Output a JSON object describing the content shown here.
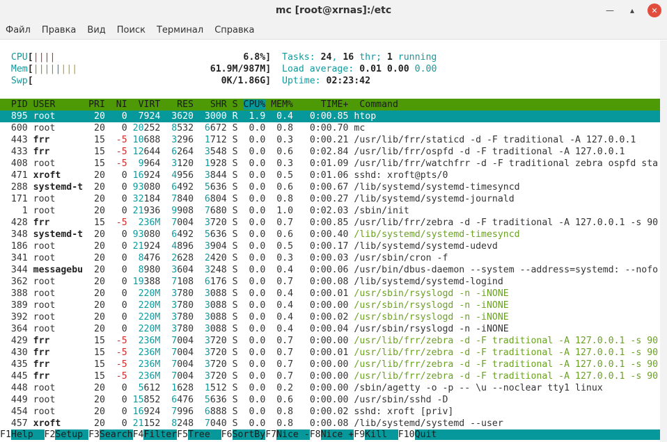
{
  "window": {
    "title": "mc [root@xrnas]:/etc"
  },
  "menu": [
    "Файл",
    "Правка",
    "Вид",
    "Поиск",
    "Терминал",
    "Справка"
  ],
  "meters": {
    "cpu": {
      "label": "CPU",
      "bars": "||||",
      "value": "6.8%"
    },
    "mem": {
      "label": "Mem",
      "bars_green": "||||",
      "bars_blue": "|",
      "bars_yellow": "|||",
      "value": "61.9M/987M"
    },
    "swp": {
      "label": "Swp",
      "value": "0K/1.86G"
    },
    "tasks_label": "Tasks: ",
    "tasks": "24",
    "thr": "16",
    "thr_label": " thr; ",
    "running": "1",
    "running_label": " running",
    "load_label": "Load average: ",
    "load1": "0.01",
    "load5": "0.00",
    "load15": "0.00",
    "uptime_label": "Uptime: ",
    "uptime": "02:23:42"
  },
  "columns": {
    "pid": "PID",
    "user": "USER",
    "pri": "PRI",
    "ni": "NI",
    "virt": "VIRT",
    "res": "RES",
    "shr": "SHR",
    "s": "S",
    "cpu": "CPU%",
    "mem": "MEM%",
    "time": "TIME+",
    "cmd": "Command"
  },
  "processes": [
    {
      "pid": "895",
      "user": "root",
      "pri": "20",
      "ni": "0",
      "virt": "7924",
      "res": "3620",
      "shr": "3000",
      "s": "R",
      "cpu": "1.9",
      "mem": "0.4",
      "time": "0:00.85",
      "cmd": "htop",
      "selected": true
    },
    {
      "pid": "600",
      "user": "root",
      "pri": "20",
      "ni": "0",
      "virt": "20252",
      "res": "8532",
      "shr": "6672",
      "s": "S",
      "cpu": "0.0",
      "mem": "0.8",
      "time": "0:00.70",
      "cmd": "mc"
    },
    {
      "pid": "443",
      "user": "frr",
      "pri": "15",
      "ni": "-5",
      "virt": "10688",
      "res": "3296",
      "shr": "1712",
      "s": "S",
      "cpu": "0.0",
      "mem": "0.3",
      "time": "0:00.21",
      "cmd": "/usr/lib/frr/staticd -d -F traditional -A 127.0.0.1"
    },
    {
      "pid": "433",
      "user": "frr",
      "pri": "15",
      "ni": "-5",
      "virt": "12644",
      "res": "6264",
      "shr": "3548",
      "s": "S",
      "cpu": "0.0",
      "mem": "0.6",
      "time": "0:02.84",
      "cmd": "/usr/lib/frr/ospfd -d -F traditional -A 127.0.0.1"
    },
    {
      "pid": "408",
      "user": "root",
      "pri": "15",
      "ni": "-5",
      "virt": "9964",
      "res": "3120",
      "shr": "1928",
      "s": "S",
      "cpu": "0.0",
      "mem": "0.3",
      "time": "0:01.09",
      "cmd": "/usr/lib/frr/watchfrr -d -F traditional zebra ospfd sta"
    },
    {
      "pid": "471",
      "user": "xroft",
      "pri": "20",
      "ni": "0",
      "virt": "16924",
      "res": "4956",
      "shr": "3844",
      "s": "S",
      "cpu": "0.0",
      "mem": "0.5",
      "time": "0:01.06",
      "cmd": "sshd: xroft@pts/0"
    },
    {
      "pid": "288",
      "user": "systemd-t",
      "pri": "20",
      "ni": "0",
      "virt": "93080",
      "res": "6492",
      "shr": "5636",
      "s": "S",
      "cpu": "0.0",
      "mem": "0.6",
      "time": "0:00.67",
      "cmd": "/lib/systemd/systemd-timesyncd"
    },
    {
      "pid": "171",
      "user": "root",
      "pri": "20",
      "ni": "0",
      "virt": "32184",
      "res": "7840",
      "shr": "6804",
      "s": "S",
      "cpu": "0.0",
      "mem": "0.8",
      "time": "0:00.27",
      "cmd": "/lib/systemd/systemd-journald"
    },
    {
      "pid": "1",
      "user": "root",
      "pri": "20",
      "ni": "0",
      "virt": "21936",
      "res": "9908",
      "shr": "7680",
      "s": "S",
      "cpu": "0.0",
      "mem": "1.0",
      "time": "0:02.03",
      "cmd": "/sbin/init"
    },
    {
      "pid": "428",
      "user": "frr",
      "pri": "15",
      "ni": "-5",
      "virt": "236M",
      "res": "7004",
      "shr": "3720",
      "s": "S",
      "cpu": "0.0",
      "mem": "0.7",
      "time": "0:00.85",
      "cmd": "/usr/lib/frr/zebra -d -F traditional -A 127.0.0.1 -s 90"
    },
    {
      "pid": "348",
      "user": "systemd-t",
      "pri": "20",
      "ni": "0",
      "virt": "93080",
      "res": "6492",
      "shr": "5636",
      "s": "S",
      "cpu": "0.0",
      "mem": "0.6",
      "time": "0:00.40",
      "cmd": "/lib/systemd/systemd-timesyncd",
      "thread": true
    },
    {
      "pid": "186",
      "user": "root",
      "pri": "20",
      "ni": "0",
      "virt": "21924",
      "res": "4896",
      "shr": "3904",
      "s": "S",
      "cpu": "0.0",
      "mem": "0.5",
      "time": "0:00.17",
      "cmd": "/lib/systemd/systemd-udevd"
    },
    {
      "pid": "341",
      "user": "root",
      "pri": "20",
      "ni": "0",
      "virt": "8476",
      "res": "2628",
      "shr": "2420",
      "s": "S",
      "cpu": "0.0",
      "mem": "0.3",
      "time": "0:00.03",
      "cmd": "/usr/sbin/cron -f"
    },
    {
      "pid": "344",
      "user": "messagebu",
      "pri": "20",
      "ni": "0",
      "virt": "8980",
      "res": "3604",
      "shr": "3248",
      "s": "S",
      "cpu": "0.0",
      "mem": "0.4",
      "time": "0:00.06",
      "cmd": "/usr/bin/dbus-daemon --system --address=systemd: --nofo"
    },
    {
      "pid": "362",
      "user": "root",
      "pri": "20",
      "ni": "0",
      "virt": "19388",
      "res": "7108",
      "shr": "6176",
      "s": "S",
      "cpu": "0.0",
      "mem": "0.7",
      "time": "0:00.08",
      "cmd": "/lib/systemd/systemd-logind"
    },
    {
      "pid": "388",
      "user": "root",
      "pri": "20",
      "ni": "0",
      "virt": "220M",
      "res": "3780",
      "shr": "3088",
      "s": "S",
      "cpu": "0.0",
      "mem": "0.4",
      "time": "0:00.01",
      "cmd": "/usr/sbin/rsyslogd -n -iNONE",
      "thread": true
    },
    {
      "pid": "389",
      "user": "root",
      "pri": "20",
      "ni": "0",
      "virt": "220M",
      "res": "3780",
      "shr": "3088",
      "s": "S",
      "cpu": "0.0",
      "mem": "0.4",
      "time": "0:00.00",
      "cmd": "/usr/sbin/rsyslogd -n -iNONE",
      "thread": true
    },
    {
      "pid": "392",
      "user": "root",
      "pri": "20",
      "ni": "0",
      "virt": "220M",
      "res": "3780",
      "shr": "3088",
      "s": "S",
      "cpu": "0.0",
      "mem": "0.4",
      "time": "0:00.02",
      "cmd": "/usr/sbin/rsyslogd -n -iNONE",
      "thread": true
    },
    {
      "pid": "364",
      "user": "root",
      "pri": "20",
      "ni": "0",
      "virt": "220M",
      "res": "3780",
      "shr": "3088",
      "s": "S",
      "cpu": "0.0",
      "mem": "0.4",
      "time": "0:00.04",
      "cmd": "/usr/sbin/rsyslogd -n -iNONE"
    },
    {
      "pid": "429",
      "user": "frr",
      "pri": "15",
      "ni": "-5",
      "virt": "236M",
      "res": "7004",
      "shr": "3720",
      "s": "S",
      "cpu": "0.0",
      "mem": "0.7",
      "time": "0:00.00",
      "cmd": "/usr/lib/frr/zebra -d -F traditional -A 127.0.0.1 -s 90",
      "thread": true
    },
    {
      "pid": "430",
      "user": "frr",
      "pri": "15",
      "ni": "-5",
      "virt": "236M",
      "res": "7004",
      "shr": "3720",
      "s": "S",
      "cpu": "0.0",
      "mem": "0.7",
      "time": "0:00.01",
      "cmd": "/usr/lib/frr/zebra -d -F traditional -A 127.0.0.1 -s 90",
      "thread": true
    },
    {
      "pid": "435",
      "user": "frr",
      "pri": "15",
      "ni": "-5",
      "virt": "236M",
      "res": "7004",
      "shr": "3720",
      "s": "S",
      "cpu": "0.0",
      "mem": "0.7",
      "time": "0:00.00",
      "cmd": "/usr/lib/frr/zebra -d -F traditional -A 127.0.0.1 -s 90",
      "thread": true
    },
    {
      "pid": "445",
      "user": "frr",
      "pri": "15",
      "ni": "-5",
      "virt": "236M",
      "res": "7004",
      "shr": "3720",
      "s": "S",
      "cpu": "0.0",
      "mem": "0.7",
      "time": "0:00.00",
      "cmd": "/usr/lib/frr/zebra -d -F traditional -A 127.0.0.1 -s 90",
      "thread": true
    },
    {
      "pid": "448",
      "user": "root",
      "pri": "20",
      "ni": "0",
      "virt": "5612",
      "res": "1628",
      "shr": "1512",
      "s": "S",
      "cpu": "0.0",
      "mem": "0.2",
      "time": "0:00.00",
      "cmd": "/sbin/agetty -o -p -- \\u --noclear tty1 linux"
    },
    {
      "pid": "449",
      "user": "root",
      "pri": "20",
      "ni": "0",
      "virt": "15852",
      "res": "6476",
      "shr": "5636",
      "s": "S",
      "cpu": "0.0",
      "mem": "0.6",
      "time": "0:00.00",
      "cmd": "/usr/sbin/sshd -D"
    },
    {
      "pid": "454",
      "user": "root",
      "pri": "20",
      "ni": "0",
      "virt": "16924",
      "res": "7996",
      "shr": "6888",
      "s": "S",
      "cpu": "0.0",
      "mem": "0.8",
      "time": "0:00.02",
      "cmd": "sshd: xroft [priv]"
    },
    {
      "pid": "457",
      "user": "xroft",
      "pri": "20",
      "ni": "0",
      "virt": "21152",
      "res": "8248",
      "shr": "7040",
      "s": "S",
      "cpu": "0.0",
      "mem": "0.8",
      "time": "0:00.08",
      "cmd": "/lib/systemd/systemd --user"
    }
  ],
  "footer": [
    {
      "key": "F1",
      "label": "Help  "
    },
    {
      "key": "F2",
      "label": "Setup "
    },
    {
      "key": "F3",
      "label": "Search"
    },
    {
      "key": "F4",
      "label": "Filter"
    },
    {
      "key": "F5",
      "label": "Tree  "
    },
    {
      "key": "F6",
      "label": "SortBy"
    },
    {
      "key": "F7",
      "label": "Nice -"
    },
    {
      "key": "F8",
      "label": "Nice +"
    },
    {
      "key": "F9",
      "label": "Kill  "
    },
    {
      "key": "F10",
      "label": "Quit                                                    "
    }
  ],
  "colors": {
    "header_bg": "#4e9a06",
    "selected_bg": "#06989a",
    "thread_fg": "#6aa121",
    "neg_nice": "#d12a2a"
  }
}
